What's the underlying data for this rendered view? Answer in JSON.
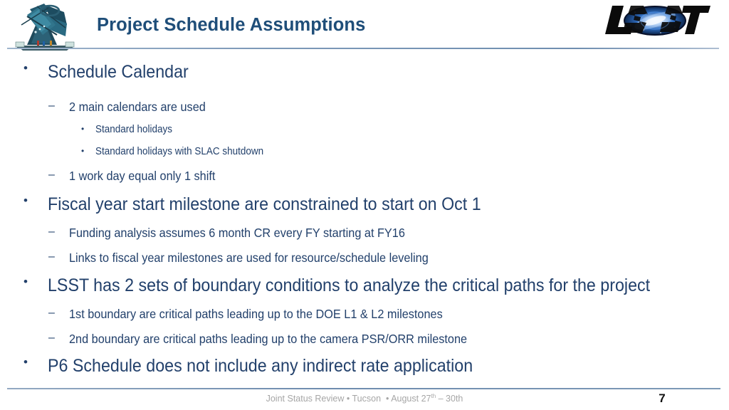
{
  "header": {
    "title": "Project Schedule Assumptions",
    "left_logo_name": "lsst-telescope-illustration",
    "right_logo_name": "lsst-galaxy-logo",
    "right_logo_text": "LSST",
    "title_color": "#1F4E79",
    "rule_color": "#7d99b8"
  },
  "body": {
    "text_color": "#22406B",
    "bullets": [
      {
        "level": 1,
        "marker": "•",
        "text": "Schedule Calendar"
      },
      {
        "level": 2,
        "marker": "–",
        "text": "2 main calendars are used"
      },
      {
        "level": 3,
        "marker": "•",
        "text": "Standard holidays"
      },
      {
        "level": 3,
        "marker": "•",
        "text": "Standard holidays with SLAC shutdown"
      },
      {
        "level": 2,
        "marker": "–",
        "text": "1 work day equal only 1 shift"
      },
      {
        "level": 1,
        "marker": "•",
        "text": "Fiscal year start milestone are constrained to start on Oct 1"
      },
      {
        "level": 2,
        "marker": "–",
        "text": "Funding analysis assumes 6 month CR every FY starting at FY16"
      },
      {
        "level": 2,
        "marker": "–",
        "text": "Links to fiscal year milestones are used for resource/schedule leveling"
      },
      {
        "level": 1,
        "marker": "•",
        "text": "LSST has 2 sets of boundary conditions to analyze the critical paths for the project"
      },
      {
        "level": 2,
        "marker": "–",
        "text": "1st boundary are critical paths leading up to the DOE L1 & L2 milestones"
      },
      {
        "level": 2,
        "marker": "–",
        "text": "2nd boundary are critical paths leading up to the camera PSR/ORR milestone"
      },
      {
        "level": 1,
        "marker": "•",
        "text": "P6 Schedule does not include any indirect rate application"
      }
    ]
  },
  "footer": {
    "event": "Joint Status Review",
    "separator": "•",
    "location": "Tucson",
    "dates_prefix": "August 27",
    "dates_superscript": "th",
    "dates_suffix": " – 30th",
    "page_number": "7",
    "text_color": "#a6a6a6"
  }
}
